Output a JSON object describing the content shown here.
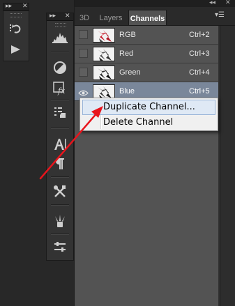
{
  "panel_controls": {
    "collapse_glyph": "▸▸",
    "close_glyph": "✕",
    "expand_glyph": "◂◂",
    "menu_glyph": "▾☰"
  },
  "tool_strip_1": {
    "tools": [
      {
        "name": "history-icon"
      },
      {
        "name": "actions-play-icon"
      }
    ]
  },
  "tool_strip_2": {
    "tools": [
      {
        "name": "histogram-icon"
      },
      {
        "name": "adjustments-icon"
      },
      {
        "name": "styles-fx-icon"
      },
      {
        "name": "layer-comps-icon"
      },
      {
        "name": "character-icon"
      },
      {
        "name": "paragraph-icon"
      },
      {
        "name": "tool-presets-icon"
      },
      {
        "name": "brushes-icon"
      },
      {
        "name": "properties-icon"
      }
    ]
  },
  "channels_panel": {
    "tabs": [
      {
        "label": "3D",
        "active": false
      },
      {
        "label": "Layers",
        "active": false
      },
      {
        "label": "Channels",
        "active": true
      }
    ],
    "channels": [
      {
        "name": "RGB",
        "shortcut": "Ctrl+2",
        "visible": false,
        "selected": false
      },
      {
        "name": "Red",
        "shortcut": "Ctrl+3",
        "visible": false,
        "selected": false
      },
      {
        "name": "Green",
        "shortcut": "Ctrl+4",
        "visible": false,
        "selected": false
      },
      {
        "name": "Blue",
        "shortcut": "Ctrl+5",
        "visible": true,
        "selected": true
      }
    ]
  },
  "context_menu": {
    "items": [
      {
        "label": "Duplicate Channel...",
        "highlighted": true
      },
      {
        "label": "Delete Channel",
        "highlighted": false
      }
    ]
  },
  "annotation": {
    "arrow_color": "#e8141c"
  },
  "colors": {
    "panel_bg": "#535353",
    "selected_row": "#7a879a",
    "menu_highlight": "#dfe9f5"
  }
}
